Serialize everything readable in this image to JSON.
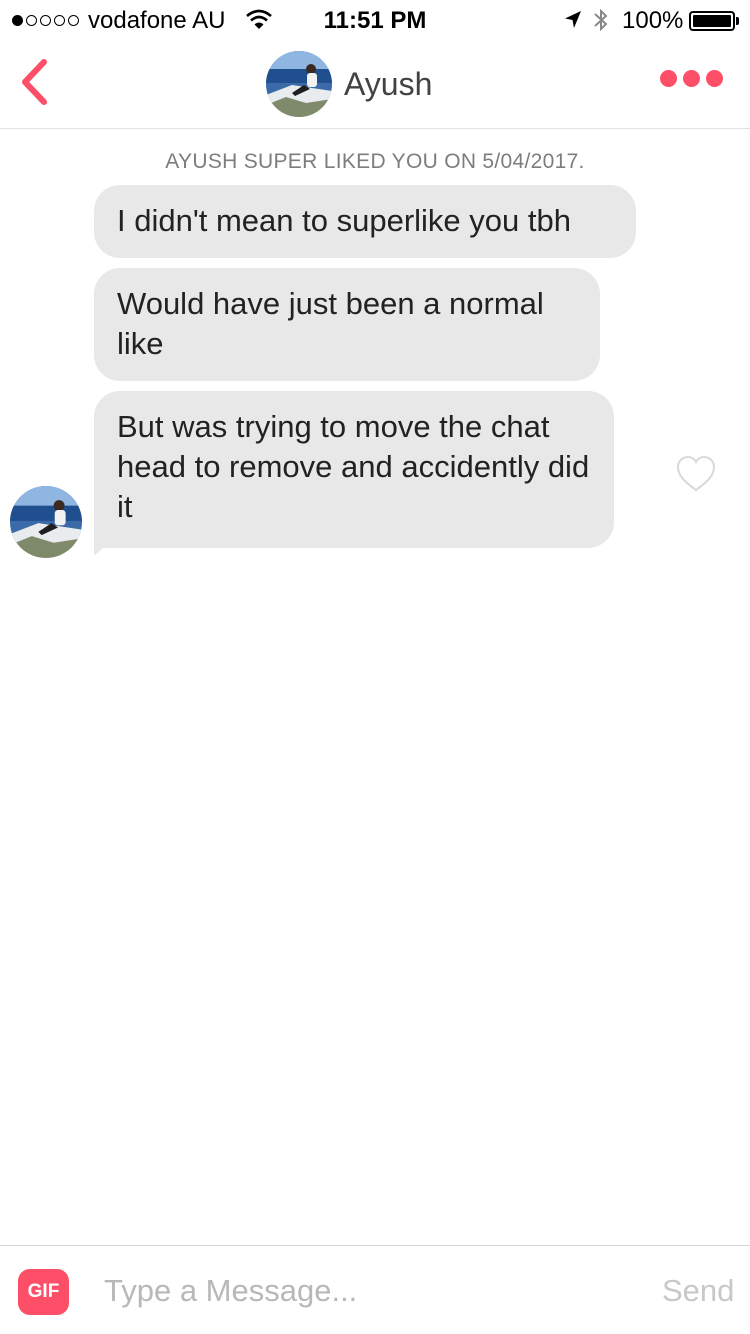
{
  "status_bar": {
    "carrier": "vodafone AU",
    "time": "11:51 PM",
    "battery": "100%",
    "signal_bars_filled": 1,
    "signal_bars_total": 5
  },
  "header": {
    "contact_name": "Ayush",
    "back_icon": "chevron-left-icon",
    "menu_icon": "more-dots-icon",
    "accent_color": "#fd4f68"
  },
  "chat": {
    "system_note": "AYUSH SUPER LIKED YOU ON 5/04/2017.",
    "messages": [
      {
        "text": "I didn't mean to superlike you tbh"
      },
      {
        "text": "Would have just been a normal like"
      },
      {
        "text": "But was trying to move the chat head to remove and accidently did it"
      }
    ],
    "bubble_color": "#e8e8e8"
  },
  "composer": {
    "gif_label": "GIF",
    "placeholder": "Type a Message...",
    "value": "",
    "send_label": "Send"
  }
}
